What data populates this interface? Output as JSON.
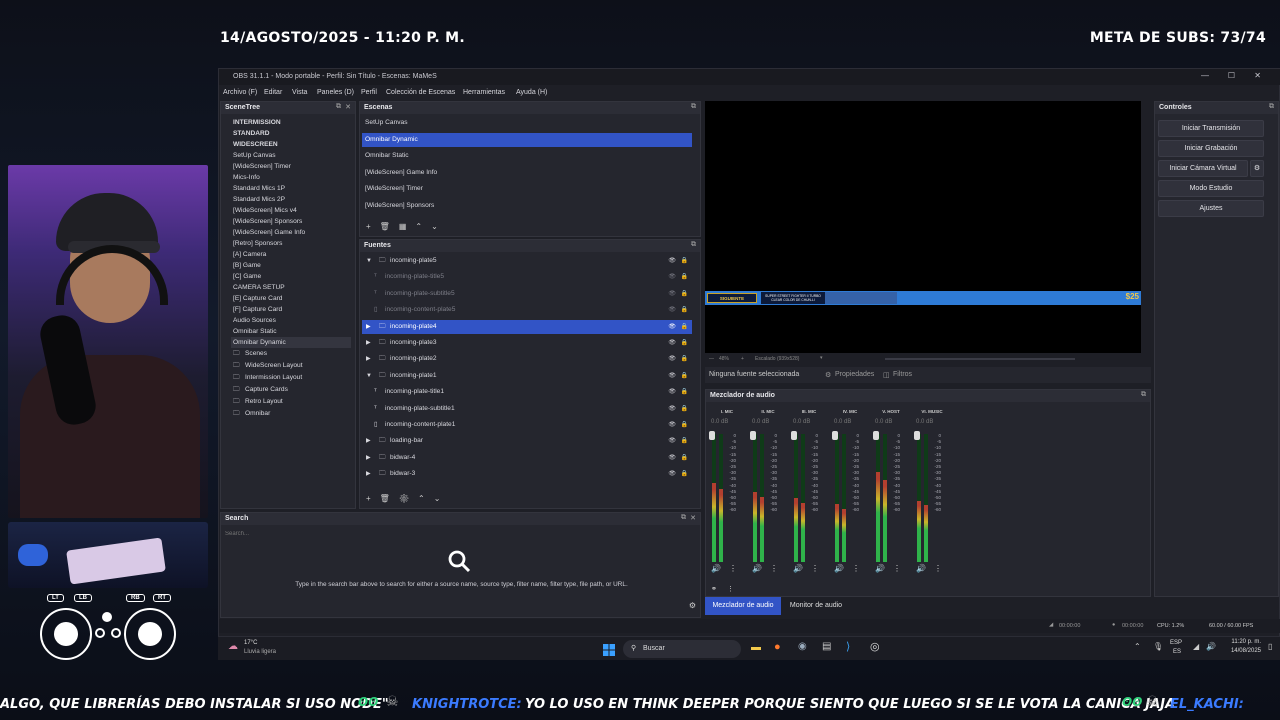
{
  "overlay": {
    "datetime": "14/AGOSTO/2025 - 11:20 P. M.",
    "subs": "META DE SUBS: 73/74"
  },
  "gamepad": {
    "lt": "LT",
    "lb": "LB",
    "rb": "RB",
    "rt": "RT"
  },
  "obs": {
    "title": "OBS 31.1.1 - Modo portable - Perfil: Sin Título - Escenas: MaMeS",
    "menu": [
      "Archivo (F)",
      "Editar",
      "Vista",
      "Paneles (D)",
      "Perfil",
      "Colección de Escenas",
      "Herramientas",
      "Ayuda (H)"
    ],
    "scenetree": {
      "title": "SceneTree",
      "groups": [
        "INTERMISSION",
        "STANDARD",
        "WIDESCREEN"
      ],
      "items": [
        "SetUp Canvas",
        "[WideScreen] Timer",
        "Mics-Info",
        "Standard Mics 1P",
        "Standard Mics 2P",
        "[WideScreen] Mics v4",
        "[WideScreen] Sponsors",
        "[WideScreen] Game Info",
        "[Retro] Sponsors",
        "[A] Camera",
        "[B] Game",
        "[C] Game",
        "CAMERA SETUP",
        "[E] Capture Card",
        "[F] Capture Card",
        "Audio Sources",
        "Omnibar Static",
        "Omnibar Dynamic"
      ],
      "folders": [
        "Scenes",
        "WideScreen Layout",
        "Intermission Layout",
        "Capture Cards",
        "Retro Layout",
        "Omnibar"
      ]
    },
    "scenes": {
      "title": "Escenas",
      "items": [
        "SetUp Canvas",
        "Omnibar Dynamic",
        "Omnibar Static",
        "[WideScreen] Game Info",
        "[WideScreen] Timer",
        "[WideScreen] Sponsors"
      ],
      "selected": 1
    },
    "sources": {
      "title": "Fuentes",
      "items": [
        {
          "label": "incoming-plate5",
          "indent": 0,
          "kind": "group-open",
          "dim": false
        },
        {
          "label": "incoming-plate-title5",
          "indent": 1,
          "kind": "text",
          "dim": true
        },
        {
          "label": "incoming-plate-subtitle5",
          "indent": 1,
          "kind": "text",
          "dim": true
        },
        {
          "label": "incoming-content-plate5",
          "indent": 1,
          "kind": "file",
          "dim": true
        },
        {
          "label": "incoming-plate4",
          "indent": 0,
          "kind": "group-closed",
          "dim": false
        },
        {
          "label": "incoming-plate3",
          "indent": 0,
          "kind": "group-closed",
          "dim": false
        },
        {
          "label": "incoming-plate2",
          "indent": 0,
          "kind": "group-closed",
          "dim": false
        },
        {
          "label": "incoming-plate1",
          "indent": 0,
          "kind": "group-open",
          "dim": false
        },
        {
          "label": "incoming-plate-title1",
          "indent": 1,
          "kind": "text",
          "dim": false
        },
        {
          "label": "incoming-plate-subtitle1",
          "indent": 1,
          "kind": "text",
          "dim": false
        },
        {
          "label": "incoming-content-plate1",
          "indent": 1,
          "kind": "file",
          "dim": false
        },
        {
          "label": "loading-bar",
          "indent": 0,
          "kind": "group-closed",
          "dim": false
        },
        {
          "label": "bidwar-4",
          "indent": 0,
          "kind": "group-closed",
          "dim": false
        },
        {
          "label": "bidwar-3",
          "indent": 0,
          "kind": "group-closed",
          "dim": false
        }
      ],
      "selected": 4
    },
    "search": {
      "title": "Search",
      "placeholder": "Search...",
      "hint": "Type in the search bar above to search for either a source name, source type, filter name, filter type, file path, or URL."
    },
    "preview": {
      "omnibar_left": "SIGUIENTE",
      "omnibar_mid": "SUPER STREET FIGHTER II TURBO CLEAR COLOR DE CHUN-LI",
      "omnibar_right": "$25",
      "zoom": "48%",
      "scale": "Escalado (939x528)"
    },
    "props_bar": {
      "none": "Ninguna fuente seleccionada",
      "properties": "Propiedades",
      "filters": "Filtros"
    },
    "controls": {
      "title": "Controles",
      "buttons": [
        "Iniciar Transmisión",
        "Iniciar Grabación",
        "Iniciar Cámara Virtual",
        "Modo Estudio",
        "Ajustes"
      ]
    },
    "mixer": {
      "title": "Mezclador de audio",
      "channels": [
        {
          "name": "I. MIC",
          "db": "0.0 dB",
          "level": 0.62
        },
        {
          "name": "II. MIC",
          "db": "0.0 dB",
          "level": 0.55
        },
        {
          "name": "III. MIC",
          "db": "0.0 dB",
          "level": 0.5
        },
        {
          "name": "IV. MIC",
          "db": "0.0 dB",
          "level": 0.45
        },
        {
          "name": "V. HOST",
          "db": "0.0 dB",
          "level": 0.7
        },
        {
          "name": "VI. MUSIC",
          "db": "0.0 dB",
          "level": 0.48
        }
      ],
      "scale": [
        "0",
        "-5",
        "-10",
        "-15",
        "-20",
        "-25",
        "-30",
        "-35",
        "-40",
        "-45",
        "-50",
        "-55",
        "-60"
      ],
      "tabs": [
        "Mezclador de audio",
        "Monitor de audio"
      ]
    },
    "status": {
      "t1": "00:00:00",
      "t2": "00:00:00",
      "cpu": "CPU: 1.2%",
      "fps": "60.00 / 60.00 FPS"
    }
  },
  "taskbar": {
    "weather_temp": "17°C",
    "weather_desc": "Lluvia ligera",
    "search": "Buscar",
    "lang": "ESP",
    "region": "ES",
    "time": "11:20 p. m.",
    "date": "14/08/2025"
  },
  "ticker": {
    "msg1": "ALGO, QUE LIBRERÍAS DEBO INSTALAR SI USO NODE\"",
    "user2": "KNIGHTROTCE:",
    "msg2": "YO LO USO EN THINK DEEPER PORQUE SIENTO QUE LUEGO SI SE LE VOTA LA CANICA JAJA",
    "user3": "EL_KACHI:",
    "colors": {
      "user": "#3b7bff",
      "msg": "#ffffff",
      "badge": "#2fd07a"
    }
  }
}
